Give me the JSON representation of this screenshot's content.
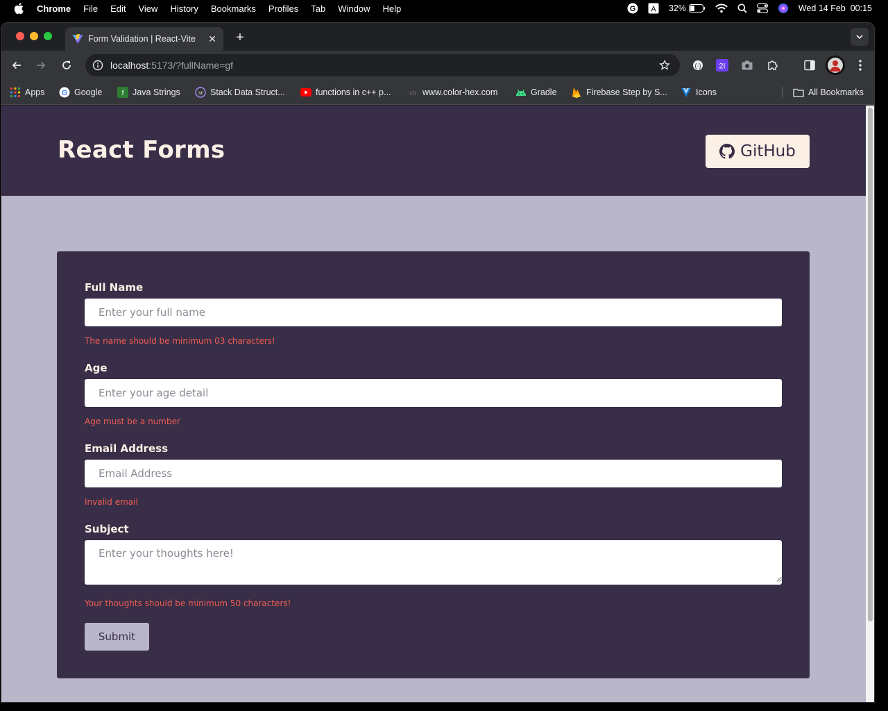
{
  "menubar": {
    "app": "Chrome",
    "items": [
      "File",
      "Edit",
      "View",
      "History",
      "Bookmarks",
      "Profiles",
      "Tab",
      "Window",
      "Help"
    ],
    "battery": "32%",
    "datetime": "Wed 14 Feb  00:15"
  },
  "browser": {
    "tab_title": "Form Validation | React-Vite",
    "url_host": "localhost",
    "url_rest": ":5173/?fullName=gf",
    "bookmarks": [
      {
        "label": "Apps",
        "icon": "apps-grid-icon"
      },
      {
        "label": "Google",
        "icon": "google-icon"
      },
      {
        "label": "Java Strings",
        "icon": "java-icon"
      },
      {
        "label": "Stack Data Struct...",
        "icon": "st-icon"
      },
      {
        "label": "functions in c++ p...",
        "icon": "youtube-icon"
      },
      {
        "label": "www.color-hex.com",
        "icon": "colorhex-icon"
      },
      {
        "label": "Gradle",
        "icon": "android-icon"
      },
      {
        "label": "Firebase Step by S...",
        "icon": "firebase-icon"
      },
      {
        "label": "Icons",
        "icon": "vuetify-icon"
      }
    ],
    "all_bookmarks": "All Bookmarks"
  },
  "page": {
    "title": "React Forms",
    "github_label": "GitHub",
    "form": {
      "full_name": {
        "label": "Full Name",
        "placeholder": "Enter your full name",
        "error": "The name should be minimum 03 characters!"
      },
      "age": {
        "label": "Age",
        "placeholder": "Enter your age detail",
        "error": "Age must be a number"
      },
      "email": {
        "label": "Email Address",
        "placeholder": "Email Address",
        "error": "Invalid email"
      },
      "subject": {
        "label": "Subject",
        "placeholder": "Enter your thoughts here!",
        "error": "Your thoughts should be minimum 50 characters!"
      },
      "submit_label": "Submit"
    }
  },
  "colors": {
    "header_bg": "#382e47",
    "page_bg": "#bab6c9",
    "accent_cream": "#fbefe6",
    "error_red": "#f25c54"
  }
}
